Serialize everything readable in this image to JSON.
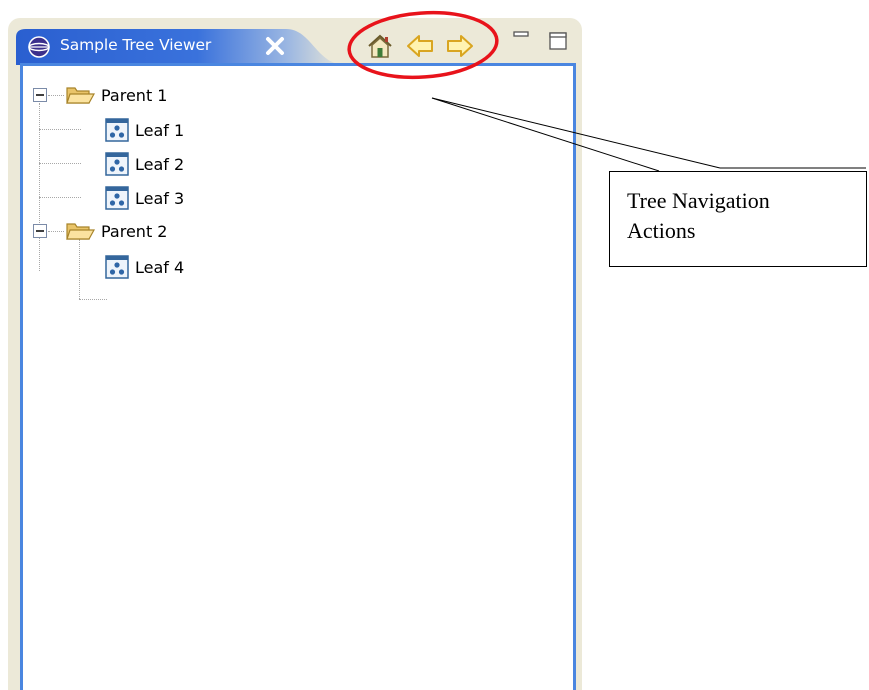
{
  "view": {
    "title": "Sample Tree Viewer",
    "close_icon": "close-icon",
    "view_icon": "globe-icon",
    "accent_color": "#4a86e0",
    "tab_gradient": [
      "#2f64d0",
      "#ece9d8"
    ]
  },
  "toolbar": {
    "actions": [
      {
        "name": "home",
        "icon": "home-icon"
      },
      {
        "name": "back",
        "icon": "back-arrow-icon"
      },
      {
        "name": "forward",
        "icon": "forward-arrow-icon"
      }
    ],
    "window_controls": [
      {
        "name": "minimize",
        "icon": "minimize-icon"
      },
      {
        "name": "maximize",
        "icon": "maximize-icon"
      }
    ]
  },
  "tree": {
    "nodes": [
      {
        "label": "Parent 1",
        "type": "folder",
        "expanded": true
      },
      {
        "label": "Leaf 1",
        "type": "leaf"
      },
      {
        "label": "Leaf 2",
        "type": "leaf"
      },
      {
        "label": "Leaf 3",
        "type": "leaf"
      },
      {
        "label": "Parent 2",
        "type": "folder",
        "expanded": true
      },
      {
        "label": "Leaf 4",
        "type": "leaf"
      }
    ]
  },
  "annotation": {
    "line1": "Tree Navigation",
    "line2": "Actions",
    "highlight_color": "#e8131b"
  }
}
